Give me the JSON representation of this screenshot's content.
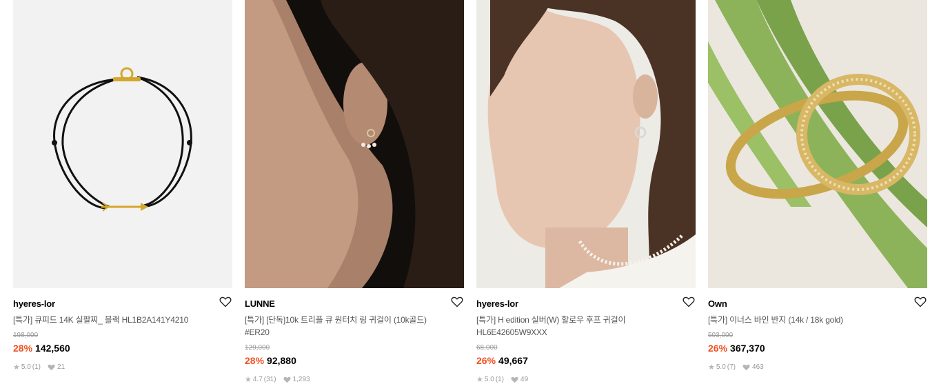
{
  "products": [
    {
      "brand": "hyeres-lor",
      "title": "[특가] 큐피드 14K 실팔찌_ 블랙 HL1B2A141Y4210",
      "original_price": "198,000",
      "discount": "28%",
      "price": "142,560",
      "rating": "5.0",
      "review_count": "(1)",
      "likes": "21",
      "image_icon": "bracelet-photo"
    },
    {
      "brand": "LUNNE",
      "title": "[특가] [단독]10k 트리플 큐 원터치 링 귀걸이 (10k골드) #ER20",
      "original_price": "129,000",
      "discount": "28%",
      "price": "92,880",
      "rating": "4.7",
      "review_count": "(31)",
      "likes": "1,293",
      "image_icon": "earring-model-photo"
    },
    {
      "brand": "hyeres-lor",
      "title": "[특가] H edition 실버(W) 할로우 후프 귀걸이 HL6E42605W9XXX",
      "original_price": "68,000",
      "discount": "26%",
      "price": "49,667",
      "rating": "5.0",
      "review_count": "(1)",
      "likes": "49",
      "image_icon": "hoop-earring-model-photo"
    },
    {
      "brand": "Own",
      "title": "[특가] 이너스 바인 반지 (14k / 18k gold)",
      "original_price": "503,000",
      "discount": "26%",
      "price": "367,370",
      "rating": "5.0",
      "review_count": "(7)",
      "likes": "463",
      "image_icon": "ring-photo"
    }
  ],
  "colors": {
    "discount": "#f25022",
    "muted": "#999999",
    "text": "#000000"
  }
}
